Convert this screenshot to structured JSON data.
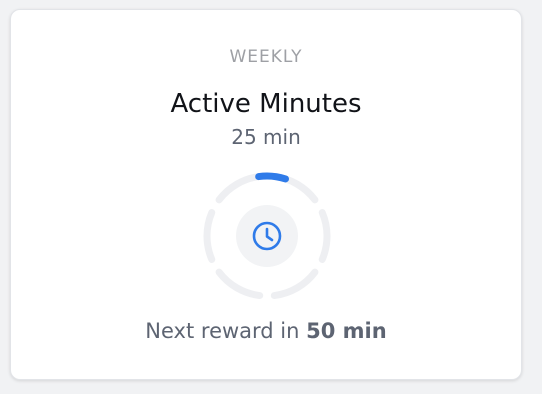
{
  "card": {
    "period_label": "WEEKLY",
    "title": "Active Minutes",
    "value_text": "25 min",
    "progress": 0.05,
    "segments": 6,
    "icon": "clock-icon",
    "footer": {
      "prefix": "Next reward in ",
      "remaining": "50 min"
    }
  },
  "colors": {
    "accent": "#2f7be9",
    "track": "#eeeff2"
  }
}
